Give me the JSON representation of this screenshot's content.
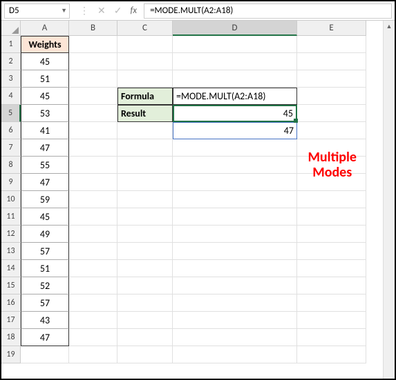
{
  "namebox": {
    "value": "D5"
  },
  "formula_bar": {
    "value": "=MODE.MULT(A2:A18)"
  },
  "columns": [
    "A",
    "B",
    "C",
    "D",
    "E"
  ],
  "rows": [
    "1",
    "2",
    "3",
    "4",
    "5",
    "6",
    "7",
    "8",
    "9",
    "10",
    "11",
    "12",
    "13",
    "14",
    "15",
    "16",
    "17",
    "18",
    "19"
  ],
  "header_a": "Weights",
  "weights": [
    "45",
    "51",
    "45",
    "53",
    "41",
    "47",
    "55",
    "47",
    "59",
    "45",
    "49",
    "57",
    "51",
    "52",
    "57",
    "43",
    "47"
  ],
  "labels": {
    "formula": "Formula",
    "result": "Result"
  },
  "values": {
    "formula_text": "=MODE.MULT(A2:A18)",
    "result1": "45",
    "result2": "47"
  },
  "annotation": {
    "line1": "Multiple",
    "line2": "Modes"
  },
  "selected_col": "D",
  "selected_row": "5"
}
